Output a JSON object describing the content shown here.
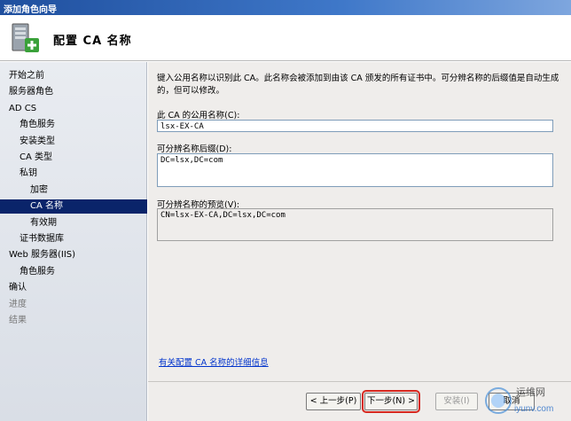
{
  "window": {
    "title": "添加角色向导"
  },
  "header": {
    "title": "配置 CA 名称"
  },
  "sidebar": {
    "items": [
      {
        "label": "开始之前",
        "state": "normal",
        "indent": 0
      },
      {
        "label": "服务器角色",
        "state": "normal",
        "indent": 0
      },
      {
        "label": "AD CS",
        "state": "normal",
        "indent": 0
      },
      {
        "label": "角色服务",
        "state": "normal",
        "indent": 1
      },
      {
        "label": "安装类型",
        "state": "normal",
        "indent": 1
      },
      {
        "label": "CA 类型",
        "state": "normal",
        "indent": 1
      },
      {
        "label": "私钥",
        "state": "normal",
        "indent": 1
      },
      {
        "label": "加密",
        "state": "normal",
        "indent": 2
      },
      {
        "label": "CA 名称",
        "state": "selected",
        "indent": 2
      },
      {
        "label": "有效期",
        "state": "normal",
        "indent": 2
      },
      {
        "label": "证书数据库",
        "state": "normal",
        "indent": 1
      },
      {
        "label": "Web 服务器(IIS)",
        "state": "normal",
        "indent": 0
      },
      {
        "label": "角色服务",
        "state": "normal",
        "indent": 1
      },
      {
        "label": "确认",
        "state": "normal",
        "indent": 0
      },
      {
        "label": "进度",
        "state": "dim",
        "indent": 0
      },
      {
        "label": "结果",
        "state": "dim",
        "indent": 0
      }
    ]
  },
  "main": {
    "description": "键入公用名称以识别此 CA。此名称会被添加到由该 CA 颁发的所有证书中。可分辨名称的后缀值是自动生成的，但可以修改。",
    "common_name_label": "此 CA 的公用名称(C):",
    "common_name_value": "lsx-EX-CA",
    "dn_suffix_label": "可分辨名称后缀(D):",
    "dn_suffix_value": "DC=lsx,DC=com",
    "preview_label": "可分辨名称的预览(V):",
    "preview_value": "CN=lsx-EX-CA,DC=lsx,DC=com",
    "more_info_link": "有关配置 CA 名称的详细信息"
  },
  "buttons": {
    "back": "< 上一步(P)",
    "next": "下一步(N) >",
    "install": "安装(I)",
    "cancel": "取消"
  },
  "watermark": {
    "text_cn": "运维网",
    "text_en": "iyunv.com"
  }
}
